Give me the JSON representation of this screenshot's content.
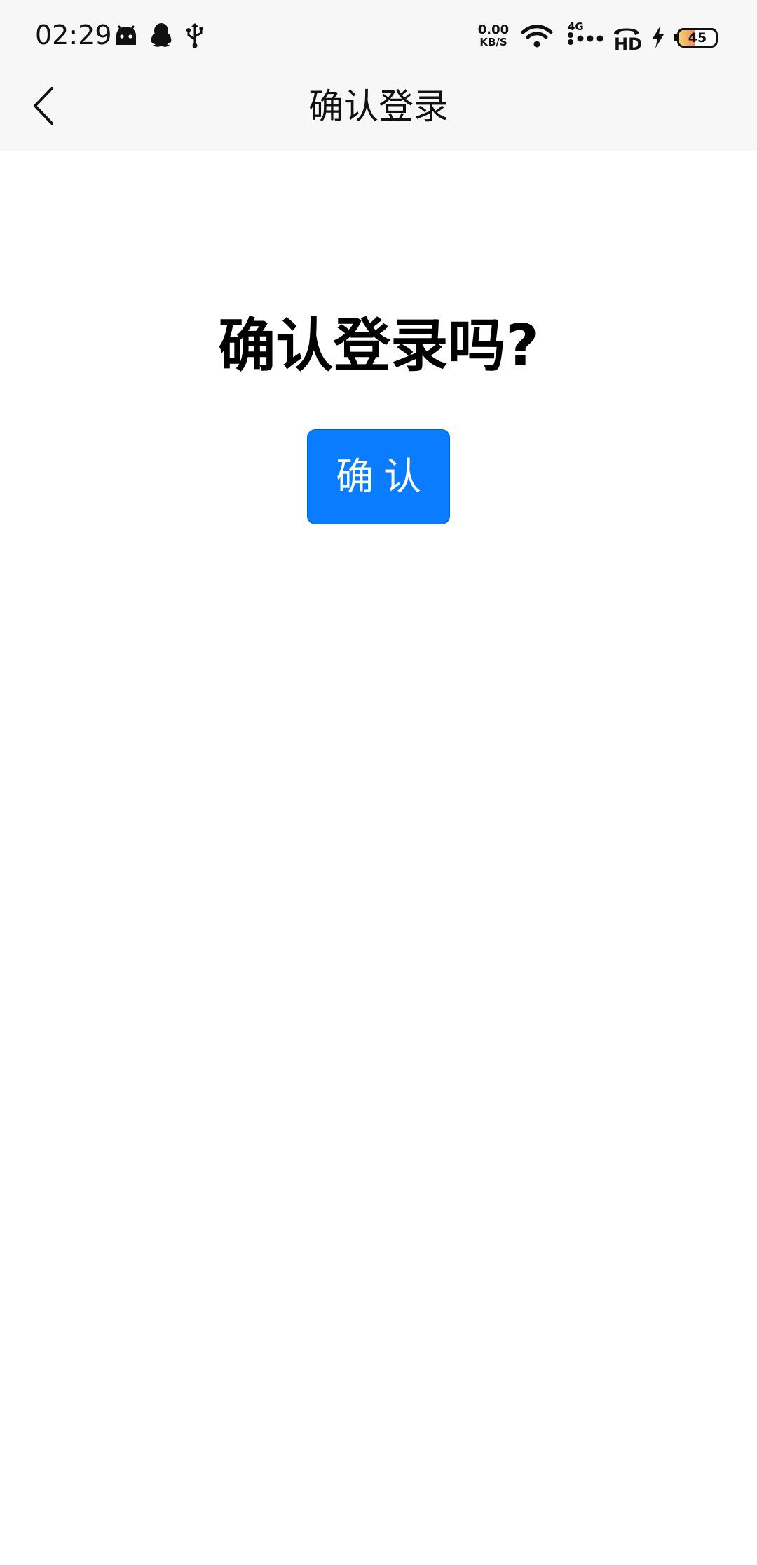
{
  "status_bar": {
    "time": "02:29",
    "net_speed_value": "0.00",
    "net_speed_unit": "KB/S",
    "network_type": "4G",
    "call_quality": "HD",
    "battery_level": "45",
    "battery_fraction": 0.45,
    "icons": [
      "android-icon",
      "qq-icon",
      "usb-icon",
      "wifi-icon",
      "signal-icon",
      "volte-hd-icon",
      "charging-icon",
      "battery-icon"
    ]
  },
  "header": {
    "title": "确认登录",
    "back_icon": "chevron-left-icon"
  },
  "main": {
    "heading": "确认登录吗?",
    "confirm_label": "确认"
  },
  "colors": {
    "accent": "#0a7cff",
    "header_bg": "#f7f7f7",
    "page_bg": "#ffffff"
  }
}
